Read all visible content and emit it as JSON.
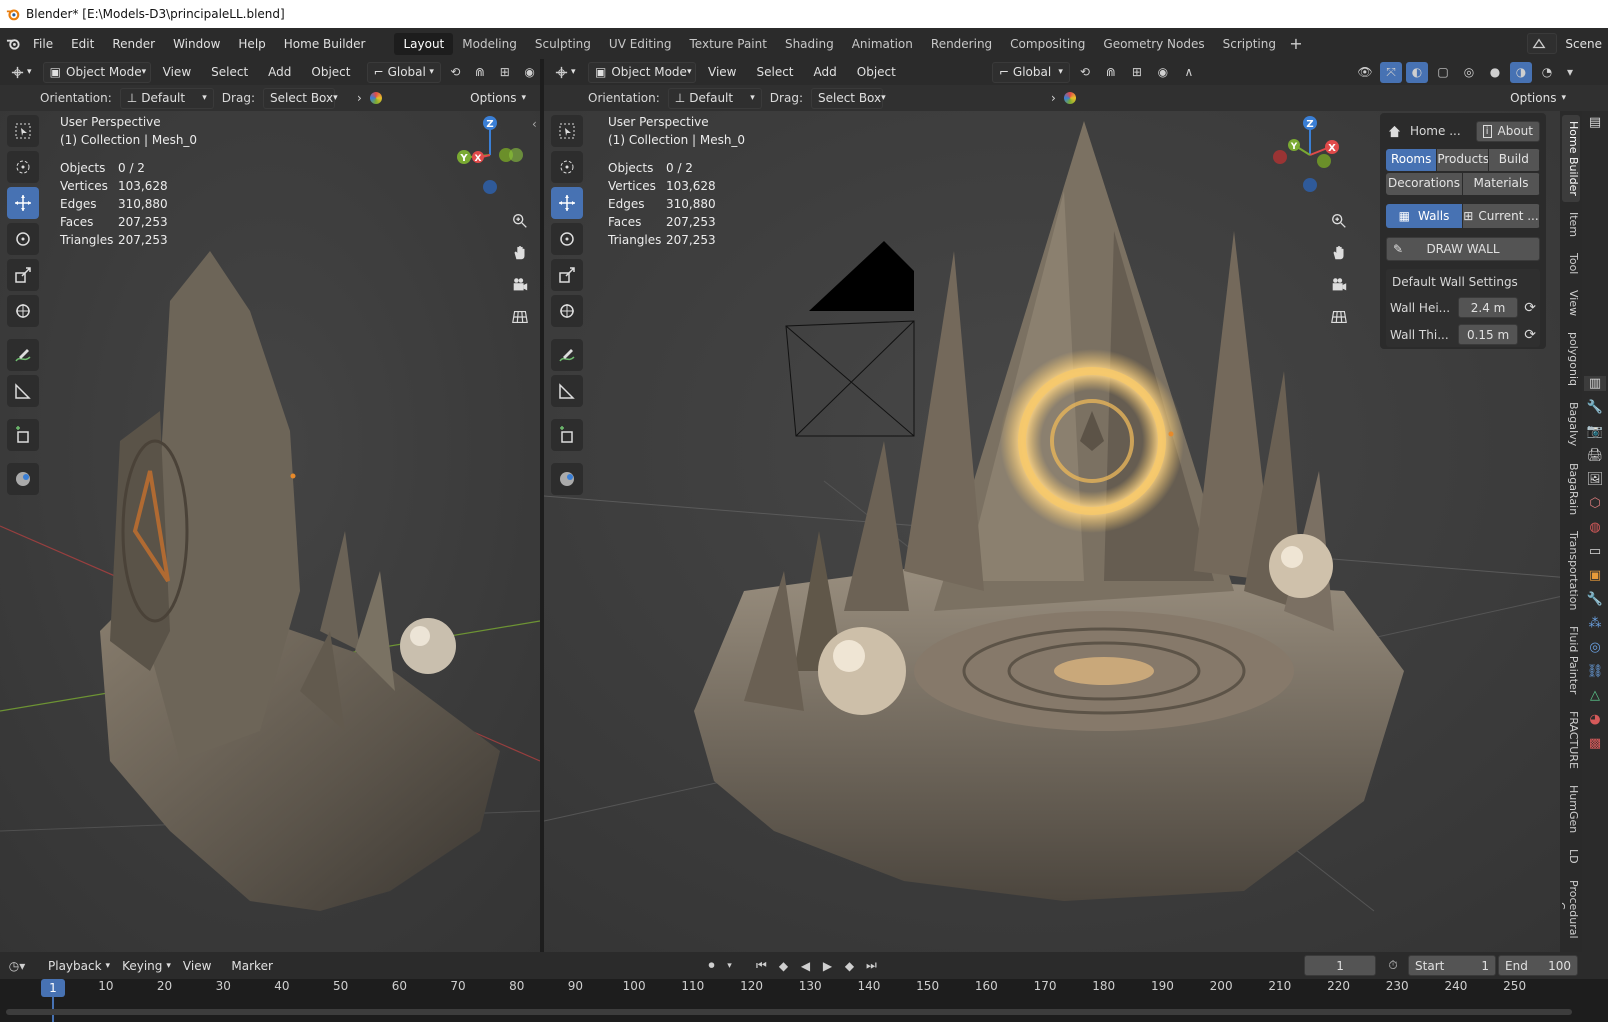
{
  "window": {
    "title": "Blender* [E:\\Models-D3\\principaleLL.blend]"
  },
  "menus": [
    "File",
    "Edit",
    "Render",
    "Window",
    "Help",
    "Home Builder"
  ],
  "workspaces": [
    {
      "label": "Layout",
      "active": true
    },
    {
      "label": "Modeling"
    },
    {
      "label": "Sculpting"
    },
    {
      "label": "UV Editing"
    },
    {
      "label": "Texture Paint"
    },
    {
      "label": "Shading"
    },
    {
      "label": "Animation"
    },
    {
      "label": "Rendering"
    },
    {
      "label": "Compositing"
    },
    {
      "label": "Geometry Nodes"
    },
    {
      "label": "Scripting"
    }
  ],
  "scene": {
    "label": "Scene"
  },
  "viewport_header": {
    "mode": "Object Mode",
    "menus": [
      "View",
      "Select",
      "Add",
      "Object"
    ],
    "transform_space": "Global",
    "orientation_label": "Orientation:",
    "orientation_value": "Default",
    "drag_label": "Drag:",
    "drag_value": "Select Box",
    "options_label": "Options"
  },
  "overlay": {
    "view_name": "User Perspective",
    "collection": "(1) Collection | Mesh_0",
    "stats": [
      {
        "label": "Objects",
        "value": "0 / 2"
      },
      {
        "label": "Vertices",
        "value": "103,628"
      },
      {
        "label": "Edges",
        "value": "310,880"
      },
      {
        "label": "Faces",
        "value": "207,253"
      },
      {
        "label": "Triangles",
        "value": "207,253"
      }
    ]
  },
  "gizmo": {
    "x": "X",
    "y": "Y",
    "z": "Z"
  },
  "home_builder": {
    "home_tab": "Home ...",
    "about": "About",
    "categories": [
      {
        "label": "Rooms",
        "active": true
      },
      {
        "label": "Products"
      },
      {
        "label": "Build"
      }
    ],
    "categories2": [
      "Decorations",
      "Materials"
    ],
    "walls_tab": "Walls",
    "current_tab": "Current ...",
    "draw_wall": "DRAW WALL",
    "settings_title": "Default Wall Settings",
    "wall_height_label": "Wall Hei...",
    "wall_height_value": "2.4 m",
    "wall_thickness_label": "Wall Thi...",
    "wall_thickness_value": "0.15 m"
  },
  "side_tabs": [
    "Home Builder",
    "Item",
    "Tool",
    "View",
    "polygoniq",
    "BagaIvy",
    "BagaRain",
    "Transportation",
    "Fluid Painter",
    "FRACTURE",
    "HumGen",
    "LD",
    "Procedural C"
  ],
  "timeline": {
    "menus": [
      "Playback",
      "Keying",
      "View",
      "Marker"
    ],
    "current_frame": "1",
    "start_label": "Start",
    "start_value": "1",
    "end_label": "End",
    "end_value": "100",
    "ticks": [
      "1",
      "10",
      "20",
      "30",
      "40",
      "50",
      "60",
      "70",
      "80",
      "90",
      "100",
      "110",
      "120",
      "130",
      "140",
      "150",
      "160",
      "170",
      "180",
      "190",
      "200",
      "210",
      "220",
      "230",
      "240",
      "250"
    ]
  },
  "colors": {
    "accent": "#4772b3",
    "axis_x": "#e04a4a",
    "axis_y": "#7aaa32",
    "axis_z": "#3a7fd6"
  }
}
